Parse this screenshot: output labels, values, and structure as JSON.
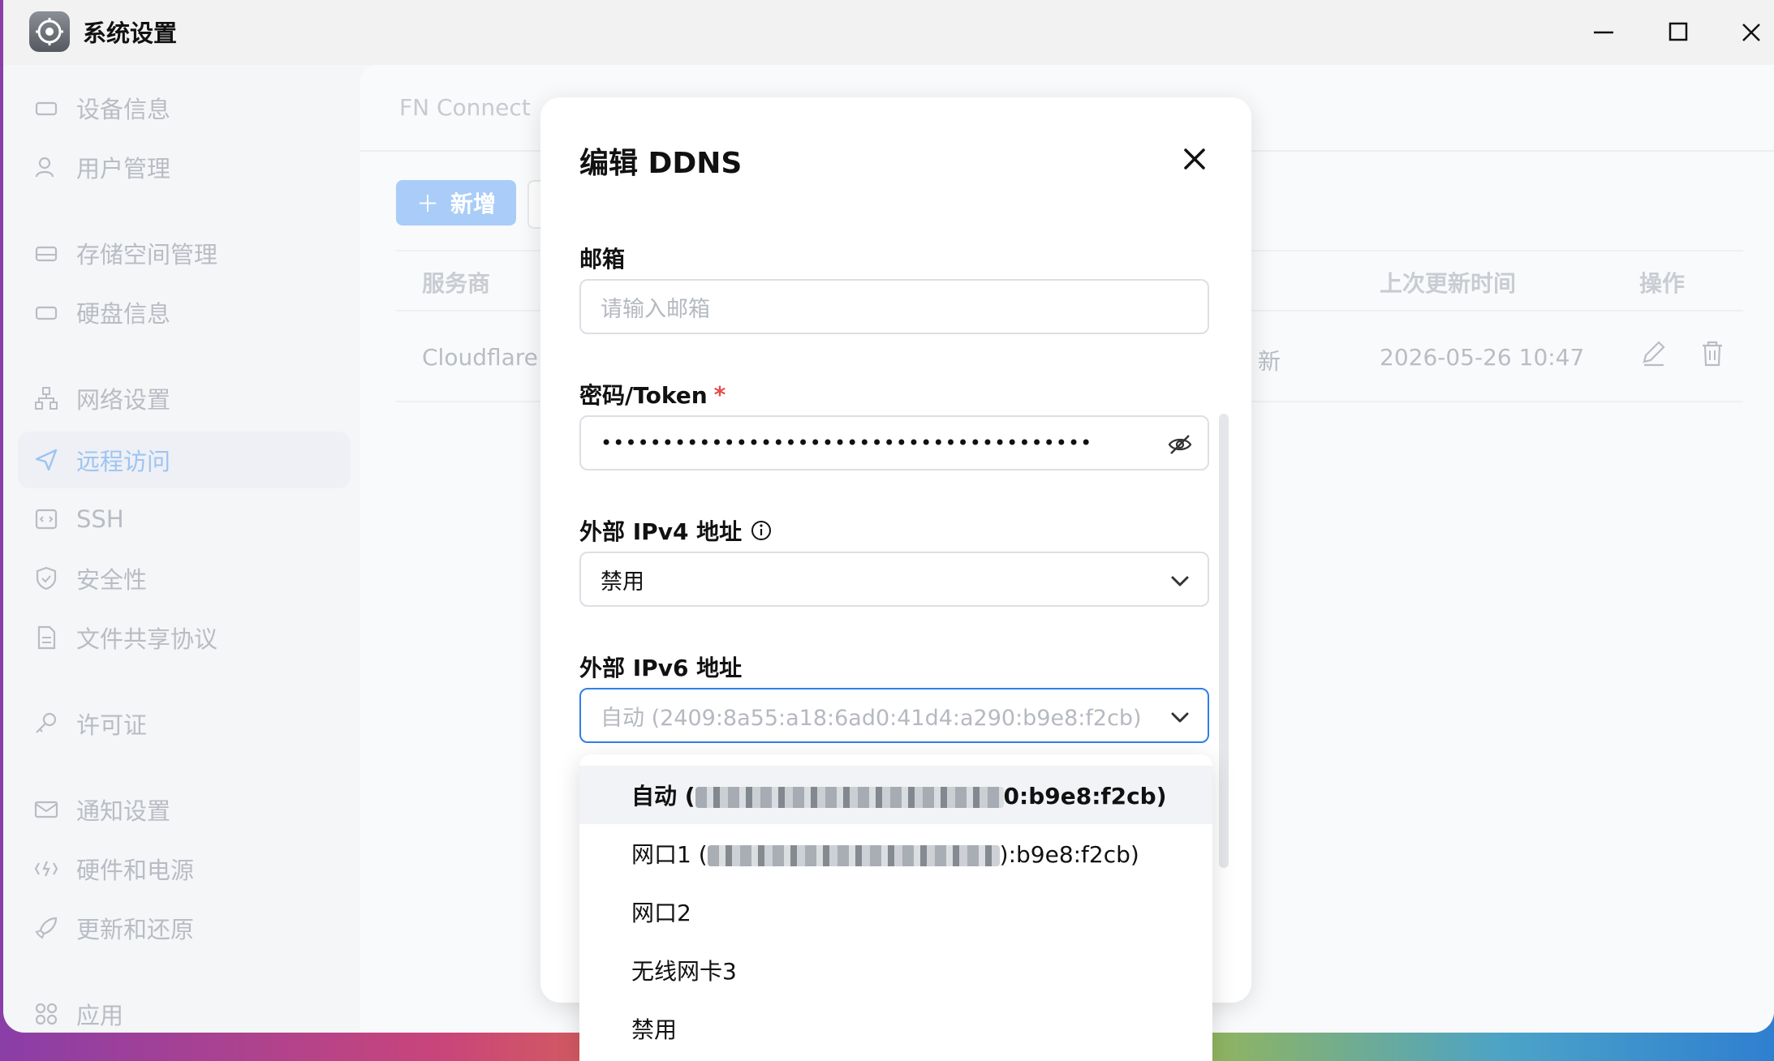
{
  "window": {
    "title": "系统设置",
    "controls": [
      "minimize-icon",
      "maximize-icon",
      "close-icon"
    ]
  },
  "sidebar": {
    "items": [
      {
        "label": "设备信息",
        "icon": "drive-icon"
      },
      {
        "label": "用户管理",
        "icon": "user-icon"
      },
      {
        "label": "存储空间管理",
        "icon": "storage-icon"
      },
      {
        "label": "硬盘信息",
        "icon": "disk-icon"
      },
      {
        "label": "网络设置",
        "icon": "network-icon"
      },
      {
        "label": "远程访问",
        "icon": "send-icon",
        "active": true
      },
      {
        "label": "SSH",
        "icon": "terminal-icon"
      },
      {
        "label": "安全性",
        "icon": "shield-icon"
      },
      {
        "label": "文件共享协议",
        "icon": "file-icon"
      },
      {
        "label": "许可证",
        "icon": "key-icon"
      },
      {
        "label": "通知设置",
        "icon": "mail-icon"
      },
      {
        "label": "硬件和电源",
        "icon": "power-icon"
      },
      {
        "label": "更新和还原",
        "icon": "rocket-icon"
      },
      {
        "label": "应用",
        "icon": "apps-icon"
      }
    ]
  },
  "content": {
    "tab": "FN Connect",
    "add_label": "新增",
    "columns": {
      "provider": "服务商",
      "last_update": "上次更新时间",
      "actions": "操作"
    },
    "rows": [
      {
        "provider": "Cloudflare",
        "status": "新",
        "last_update": "2026-05-26 10:47"
      }
    ]
  },
  "modal": {
    "title": "编辑 DDNS",
    "email": {
      "label": "邮箱",
      "placeholder": "请输入邮箱"
    },
    "token": {
      "label": "密码/Token",
      "required_mark": "*",
      "masked": "••••••••••••••••••••••••••••••••••••••••"
    },
    "ipv4": {
      "label": "外部 IPv4 地址",
      "value": "禁用"
    },
    "ipv6": {
      "label": "外部 IPv6 地址",
      "value": "自动 (2409:8a55:a18:6ad0:41d4:a290:b9e8:f2cb)"
    }
  },
  "dropdown": {
    "options": [
      {
        "prefix": "自动 (",
        "suffix": "0:b9e8:f2cb)",
        "selected": true
      },
      {
        "prefix": "网口1 (",
        "suffix": "):b9e8:f2cb)",
        "selected": false
      },
      {
        "prefix": "网口2",
        "suffix": "",
        "selected": false
      },
      {
        "prefix": "无线网卡3",
        "suffix": "",
        "selected": false
      },
      {
        "prefix": "禁用",
        "suffix": "",
        "selected": false
      }
    ]
  },
  "colors": {
    "accent": "#2f7fe8",
    "active_nav": "#9ec4f3",
    "required": "#e34d4d"
  }
}
